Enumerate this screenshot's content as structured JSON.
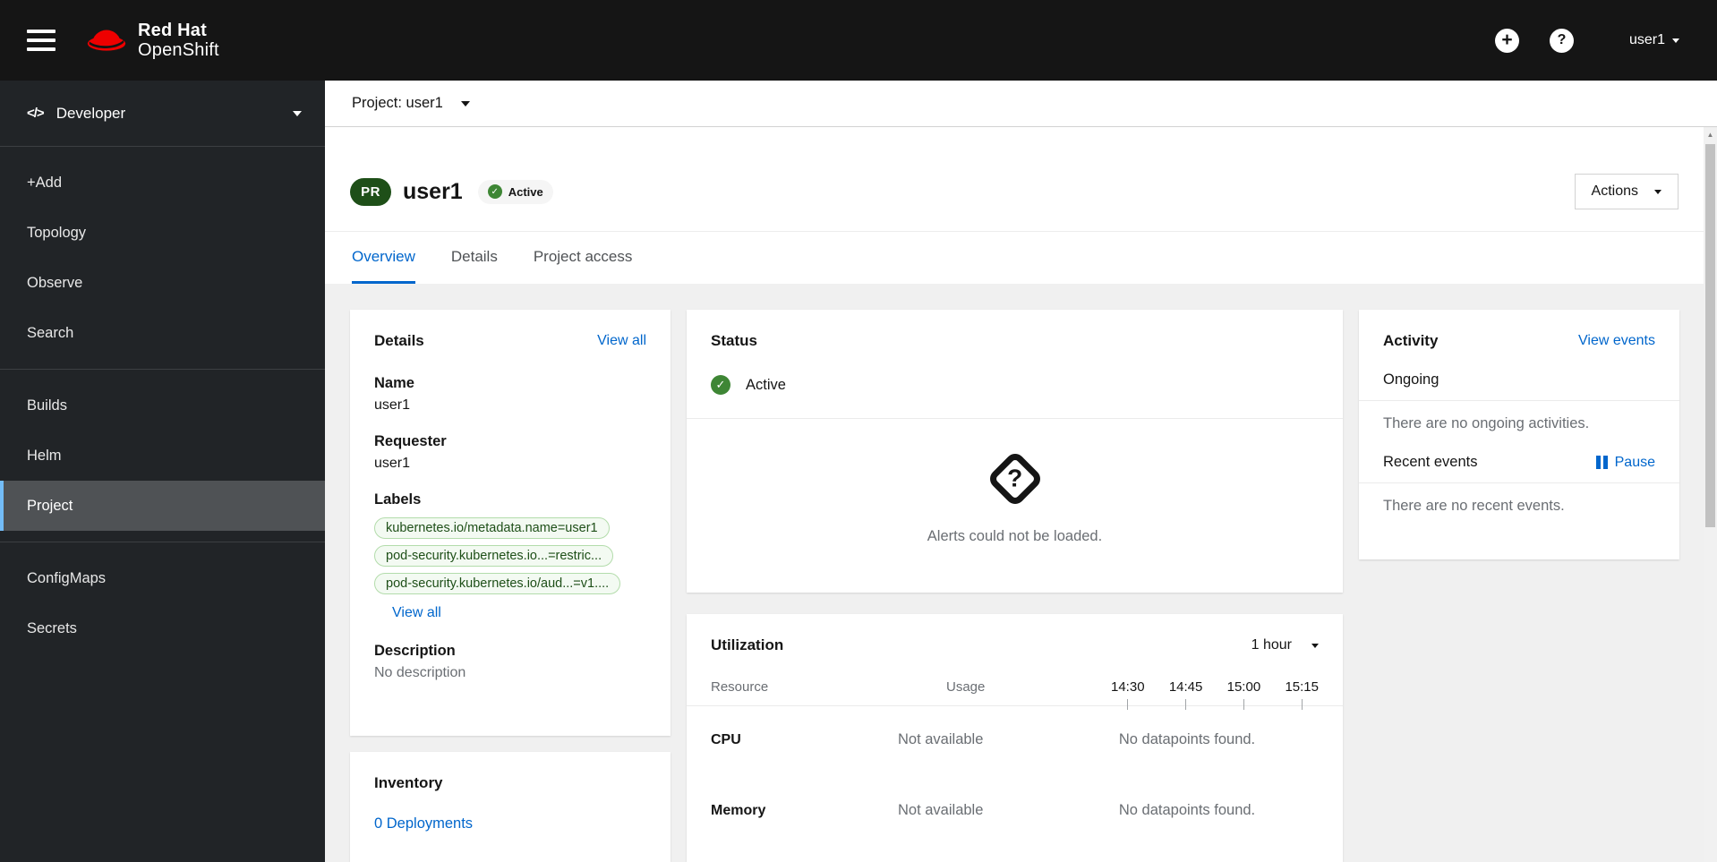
{
  "masthead": {
    "brand_line1": "Red Hat",
    "brand_line2": "OpenShift",
    "user_menu": "user1"
  },
  "icons": {
    "add_glyph": "+",
    "help_glyph": "?",
    "code_glyph": "</>",
    "alerts_glyph": "?",
    "scroll_up_glyph": "▲"
  },
  "sidebar": {
    "perspective": "Developer",
    "group1": [
      "+Add",
      "Topology",
      "Observe",
      "Search"
    ],
    "group2": [
      "Builds",
      "Helm",
      "Project"
    ],
    "group3": [
      "ConfigMaps",
      "Secrets"
    ],
    "selected_item": "Project"
  },
  "project_bar": {
    "selector": "Project: user1"
  },
  "page_header": {
    "badge": "PR",
    "title": "user1",
    "status_badge": "Active",
    "actions_button": "Actions"
  },
  "tabs": {
    "items": [
      "Overview",
      "Details",
      "Project access"
    ],
    "active": "Overview"
  },
  "details_card": {
    "title": "Details",
    "view_all_link": "View all",
    "name_label": "Name",
    "name_value": "user1",
    "requester_label": "Requester",
    "requester_value": "user1",
    "labels_label": "Labels",
    "labels": [
      "kubernetes.io/metadata.name=user1",
      "pod-security.kubernetes.io...=restric...",
      "pod-security.kubernetes.io/aud...=v1...."
    ],
    "labels_view_all_link": "View all",
    "description_label": "Description",
    "description_value": "No description"
  },
  "status_card": {
    "title": "Status",
    "status": "Active",
    "alerts_message": "Alerts could not be loaded."
  },
  "activity_card": {
    "title": "Activity",
    "view_events_link": "View events",
    "ongoing_heading": "Ongoing",
    "ongoing_empty": "There are no ongoing activities.",
    "recent_heading": "Recent events",
    "pause_button": "Pause",
    "recent_empty": "There are no recent events."
  },
  "utilization_card": {
    "title": "Utilization",
    "duration_selector": "1 hour",
    "resource_column": "Resource",
    "usage_column": "Usage",
    "time_labels": [
      "14:30",
      "14:45",
      "15:00",
      "15:15"
    ],
    "rows": [
      {
        "resource": "CPU",
        "usage": "Not available",
        "datapoints": "No datapoints found."
      },
      {
        "resource": "Memory",
        "usage": "Not available",
        "datapoints": "No datapoints found."
      }
    ]
  },
  "inventory_card": {
    "title": "Inventory",
    "links": [
      "0 Deployments"
    ]
  },
  "colors": {
    "link_blue": "#0066cc",
    "status_green": "#3e8635",
    "project_badge_green": "#1e4f18",
    "masthead_bg": "#151515",
    "sidebar_bg": "#212427",
    "selected_nav_bg": "#4f5255",
    "selected_nav_border": "#73bcf7",
    "page_bg": "#f0f0f0"
  }
}
